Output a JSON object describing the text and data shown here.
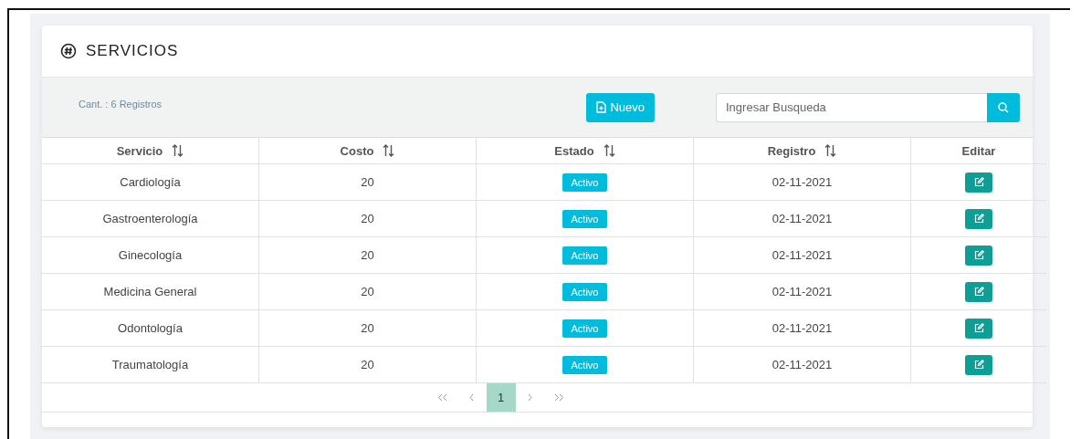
{
  "card": {
    "title": "SERVICIOS"
  },
  "toolbar": {
    "count": "Cant. : 6 Registros",
    "new_button": "Nuevo",
    "search": {
      "placeholder": "Ingresar Busqueda"
    }
  },
  "table": {
    "columns": [
      {
        "label": "Servicio",
        "sortable": true
      },
      {
        "label": "Costo",
        "sortable": true
      },
      {
        "label": "Estado",
        "sortable": true
      },
      {
        "label": "Registro",
        "sortable": true
      },
      {
        "label": "Editar",
        "sortable": false
      }
    ],
    "rows": [
      {
        "servicio": "Cardiología",
        "costo": "20",
        "estado": "Activo",
        "registro": "02-11-2021"
      },
      {
        "servicio": "Gastroenterología",
        "costo": "20",
        "estado": "Activo",
        "registro": "02-11-2021"
      },
      {
        "servicio": "Ginecología",
        "costo": "20",
        "estado": "Activo",
        "registro": "02-11-2021"
      },
      {
        "servicio": "Medicina General",
        "costo": "20",
        "estado": "Activo",
        "registro": "02-11-2021"
      },
      {
        "servicio": "Odontología",
        "costo": "20",
        "estado": "Activo",
        "registro": "02-11-2021"
      },
      {
        "servicio": "Traumatología",
        "costo": "20",
        "estado": "Activo",
        "registro": "02-11-2021"
      }
    ]
  },
  "pagination": {
    "pages": [
      {
        "label": "1",
        "selected": true
      }
    ]
  }
}
